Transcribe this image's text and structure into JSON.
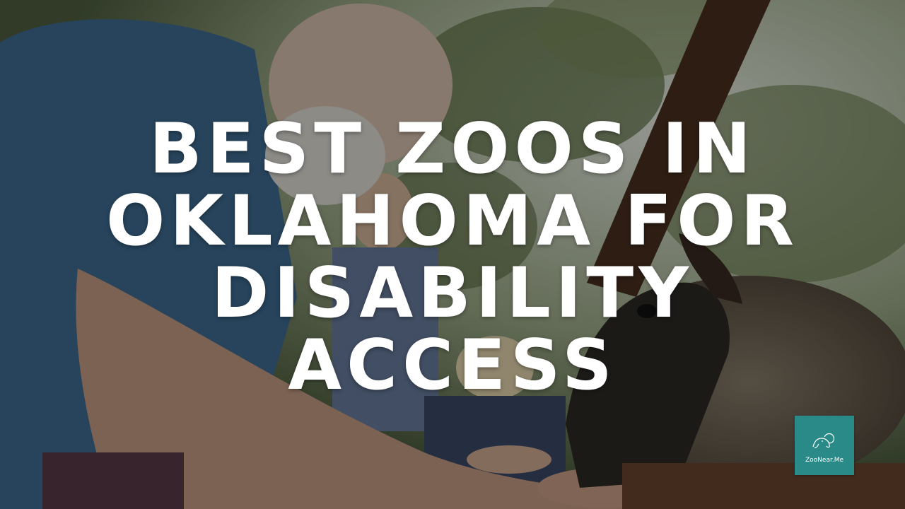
{
  "title": {
    "lines": [
      "BEST ZOOS IN",
      "OKLAHOMA FOR",
      "DISABILITY",
      "ACCESS"
    ]
  },
  "logo": {
    "text": "ZooNear.Me",
    "icon": "elephant-outline-icon",
    "color": "#2a8a87"
  },
  "colors": {
    "title_text": "#ffffff",
    "overlay": "rgba(0,0,0,0.38)"
  }
}
